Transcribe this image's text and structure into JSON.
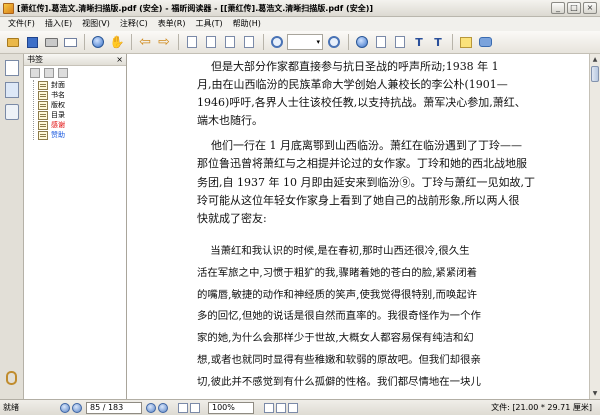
{
  "window": {
    "title": "[萧红传].葛浩文.清晰扫描版.pdf (安全) - 福昕阅读器 - [[萧红传].葛浩文.清晰扫描版.pdf (安全)]",
    "minimize": "_",
    "maximize": "□",
    "close": "×"
  },
  "menu": [
    "文件(F)",
    "插入(E)",
    "视图(V)",
    "注释(C)",
    "表单(R)",
    "工具(T)",
    "帮助(H)"
  ],
  "toolbar": {
    "icons": [
      "open-icon",
      "save-icon",
      "print-icon",
      "email-icon",
      "circle-icon",
      "back-arrow-icon",
      "forward-arrow-icon",
      "page-icon",
      "hand-icon",
      "zoom-icon",
      "note-icon",
      "comment-icon",
      "text-icon"
    ]
  },
  "bookmarks": {
    "title": "书签",
    "close": "×",
    "items": [
      {
        "label": "封面",
        "color": "#000000"
      },
      {
        "label": "书名",
        "color": "#000000"
      },
      {
        "label": "版权",
        "color": "#000000"
      },
      {
        "label": "目录",
        "color": "#000000"
      },
      {
        "label": "感谢",
        "color": "#e00000"
      },
      {
        "label": "赞助",
        "color": "#1a5ae0"
      }
    ]
  },
  "document": {
    "lines": [
      "    但是大部分作家都直接参与抗日圣战的呼声所动;1938 年 1",
      "月,由在山西临汾的民族革命大学创始人兼校长的李公朴(1901—",
      "1946)呼吁,各界人士往该校任教,以支持抗战。萧军决心参加,萧红、",
      "端木也随行。",
      "    他们一行在 1 月底离鄂到山西临汾。萧红在临汾遇到了丁玲——",
      "那位鲁迅曾将萧红与之相提并论过的女作家。丁玲和她的西北战地服",
      "务团,自 1937 年 10 月即由延安来到临汾⑨。丁玲与萧红一见如故,丁",
      "玲可能从这位年轻女作家身上看到了她自己的战前形象,所以两人很",
      "快就成了密友:"
    ],
    "quote": [
      "    当萧红和我认识的时候,是在春初,那时山西还很冷,很久生",
      "活在军旅之中,习惯于粗犷的我,骤睹着她的苍白的脸,紧紧闭着",
      "的嘴唇,敏捷的动作和神经质的笑声,使我觉得很特别,而唤起许",
      "多的回忆,但她的说话是很自然而直率的。我很奇怪作为一个作",
      "家的她,为什么会那样少于世故,大概女人都容易保有纯洁和幻",
      "想,或者也就同时显得有些稚嫩和软弱的原故吧。但我们却很亲",
      "切,彼此并不感觉到有什么孤僻的性格。我们都尽情地在一块儿"
    ]
  },
  "status": {
    "left": "就绪",
    "page": "85 / 183",
    "zoom": "100%",
    "size": "文件: [21.00 * 29.71 厘米]"
  }
}
